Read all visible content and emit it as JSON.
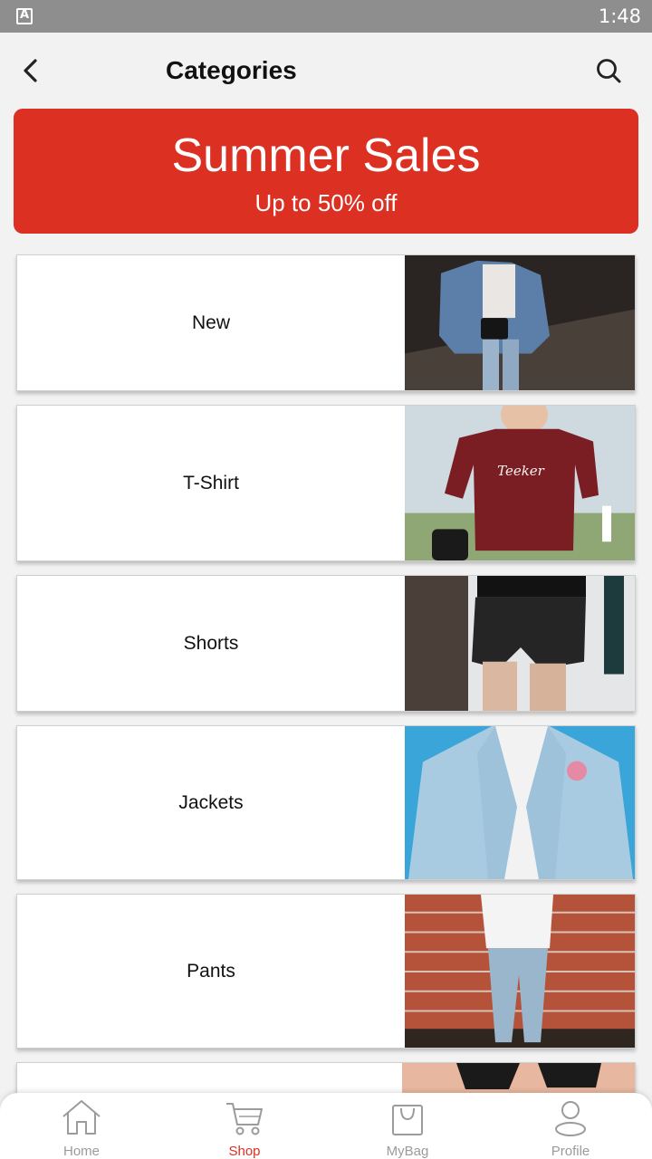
{
  "status_bar": {
    "time": "1:48"
  },
  "header": {
    "title": "Categories"
  },
  "banner": {
    "title": "Summer Sales",
    "subtitle": "Up to 50% off"
  },
  "categories": [
    {
      "label": "New"
    },
    {
      "label": "T-Shirt"
    },
    {
      "label": "Shorts"
    },
    {
      "label": "Jackets"
    },
    {
      "label": "Pants"
    }
  ],
  "bottom_nav": {
    "active": "Shop",
    "items": [
      {
        "label": "Home",
        "icon": "home-icon"
      },
      {
        "label": "Shop",
        "icon": "cart-icon"
      },
      {
        "label": "MyBag",
        "icon": "bag-icon"
      },
      {
        "label": "Profile",
        "icon": "profile-icon"
      }
    ]
  },
  "colors": {
    "accent": "#db3022",
    "inactive": "#9b9b9b",
    "background": "#f2f2f2"
  }
}
